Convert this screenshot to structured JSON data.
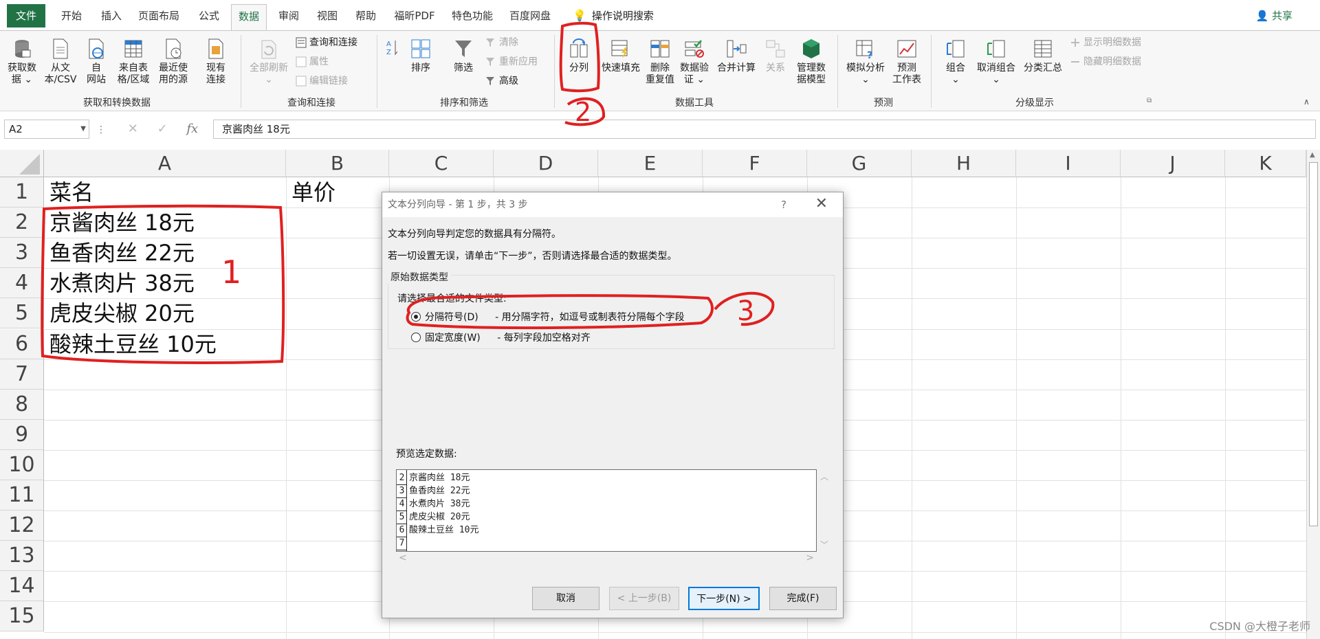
{
  "tabs": [
    "文件",
    "开始",
    "插入",
    "页面布局",
    "公式",
    "数据",
    "审阅",
    "视图",
    "帮助",
    "福昕PDF",
    "特色功能",
    "百度网盘"
  ],
  "active_tab": "数据",
  "search_label": "操作说明搜索",
  "share_label": "共享",
  "ribbon": {
    "get_data": {
      "label1": "获取数",
      "label2": "据",
      "dd": "⌄"
    },
    "from_text": {
      "label1": "从文",
      "label2": "本/CSV"
    },
    "from_web": {
      "label1": "自",
      "label2": "网站"
    },
    "from_table": {
      "label1": "来自表",
      "label2": "格/区域"
    },
    "recent": {
      "label1": "最近使",
      "label2": "用的源"
    },
    "existing": {
      "label1": "现有",
      "label2": "连接"
    },
    "group_get": "获取和转换数据",
    "refresh_all": {
      "label1": "全部刷新",
      "dd": "⌄"
    },
    "queries": "查询和连接",
    "properties": "属性",
    "edit_links": "编辑链接",
    "group_queries": "查询和连接",
    "sort": "排序",
    "filter": "筛选",
    "clear": "清除",
    "reapply": "重新应用",
    "advanced": "高级",
    "group_sort": "排序和筛选",
    "text_to_cols": "分列",
    "flash_fill": "快速填充",
    "remove_dup": {
      "label1": "删除",
      "label2": "重复值"
    },
    "validation": {
      "label1": "数据验",
      "label2": "证 ⌄"
    },
    "consolidate": "合并计算",
    "relations": "关系",
    "manage_model": {
      "label1": "管理数",
      "label2": "据模型"
    },
    "group_tools": "数据工具",
    "what_if": {
      "label1": "模拟分析",
      "dd": "⌄"
    },
    "forecast": {
      "label1": "预测",
      "label2": "工作表"
    },
    "group_forecast": "预测",
    "group_btn": {
      "label1": "组合",
      "dd": "⌄"
    },
    "ungroup": {
      "label1": "取消组合",
      "dd": "⌄"
    },
    "subtotal": "分类汇总",
    "show_detail": "显示明细数据",
    "hide_detail": "隐藏明细数据",
    "group_outline": "分级显示"
  },
  "formula_bar": {
    "name_box": "A2",
    "formula": "京酱肉丝 18元"
  },
  "columns": [
    "A",
    "B",
    "C",
    "D",
    "E",
    "F",
    "G",
    "H",
    "I",
    "J",
    "K"
  ],
  "rows": [
    "1",
    "2",
    "3",
    "4",
    "5",
    "6",
    "7",
    "8",
    "9",
    "10",
    "11",
    "12",
    "13",
    "14",
    "15"
  ],
  "cells": {
    "A1": "菜名",
    "B1": "单价",
    "A2": "京酱肉丝 18元",
    "A3": "鱼香肉丝 22元",
    "A4": "水煮肉片 38元",
    "A5": "虎皮尖椒 20元",
    "A6": "酸辣土豆丝 10元"
  },
  "dialog": {
    "title": "文本分列向导 - 第 1 步，共 3 步",
    "help": "?",
    "line1": "文本分列向导判定您的数据具有分隔符。",
    "line2": "若一切设置无误，请单击“下一步”，否则请选择最合适的数据类型。",
    "group_title": "原始数据类型",
    "prompt": "请选择最合适的文件类型:",
    "opt1": {
      "label": "分隔符号(D)",
      "desc": "- 用分隔字符，如逗号或制表符分隔每个字段",
      "selected": true
    },
    "opt2": {
      "label": "固定宽度(W)",
      "desc": "- 每列字段加空格对齐",
      "selected": false
    },
    "preview_label": "预览选定数据:",
    "preview_rows": [
      {
        "n": "2",
        "t": "京酱肉丝 18元"
      },
      {
        "n": "3",
        "t": "鱼香肉丝 22元"
      },
      {
        "n": "4",
        "t": "水煮肉片 38元"
      },
      {
        "n": "5",
        "t": "虎皮尖椒 20元"
      },
      {
        "n": "6",
        "t": "酸辣土豆丝 10元"
      },
      {
        "n": "7",
        "t": ""
      }
    ],
    "btn_cancel": "取消",
    "btn_back": "< 上一步(B)",
    "btn_next": "下一步(N) >",
    "btn_finish": "完成(F)"
  },
  "annotations": {
    "a1": "1",
    "a2": "2",
    "a3": "3",
    "color": "#e02020"
  },
  "watermark": "CSDN @大橙子老师"
}
